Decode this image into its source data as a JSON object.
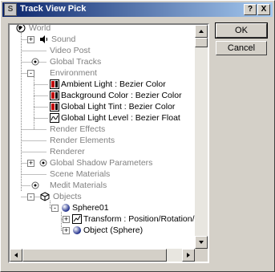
{
  "window": {
    "title": "Track View Pick",
    "help_glyph": "?",
    "close_glyph": "X",
    "app_icon_glyph": "S"
  },
  "buttons": {
    "ok": "OK",
    "cancel": "Cancel"
  },
  "tree": {
    "items": [
      {
        "label": "World",
        "icon": "world-icon",
        "dim": true
      },
      {
        "label": "Sound",
        "icon": "sound-icon",
        "dim": true,
        "expander": "+"
      },
      {
        "label": "Video Post",
        "icon": "none",
        "dim": true
      },
      {
        "label": "Global Tracks",
        "icon": "circle-dot-icon",
        "dim": true
      },
      {
        "label": "Environment",
        "icon": "none",
        "dim": true,
        "expander": "-"
      },
      {
        "label": "Ambient Light : Bezier Color",
        "icon": "color-track-icon",
        "dim": false
      },
      {
        "label": "Background Color : Bezier Color",
        "icon": "color-track-icon",
        "dim": false
      },
      {
        "label": "Global Light Tint : Bezier Color",
        "icon": "color-track-icon",
        "dim": false
      },
      {
        "label": "Global Light Level : Bezier Float",
        "icon": "float-track-icon",
        "dim": false
      },
      {
        "label": "Render Effects",
        "icon": "none",
        "dim": true
      },
      {
        "label": "Render Elements",
        "icon": "none",
        "dim": true
      },
      {
        "label": "Renderer",
        "icon": "none",
        "dim": true
      },
      {
        "label": "Global Shadow Parameters",
        "icon": "circle-dot-icon",
        "dim": true,
        "expander": "+"
      },
      {
        "label": "Scene Materials",
        "icon": "none",
        "dim": true
      },
      {
        "label": "Medit Materials",
        "icon": "circle-dot-icon",
        "dim": true
      },
      {
        "label": "Objects",
        "icon": "objects-icon",
        "dim": true,
        "expander": "-"
      },
      {
        "label": "Sphere01",
        "icon": "sphere-icon",
        "dim": false,
        "expander": "-"
      },
      {
        "label": "Transform : Position/Rotation/Scale",
        "icon": "transform-icon",
        "dim": false,
        "expander": "+"
      },
      {
        "label": "Object (Sphere)",
        "icon": "sphere-icon",
        "dim": false,
        "expander": "+"
      }
    ]
  },
  "colors": {
    "title_start": "#0a246a",
    "title_end": "#a6caf0",
    "dim_text": "#808080"
  }
}
